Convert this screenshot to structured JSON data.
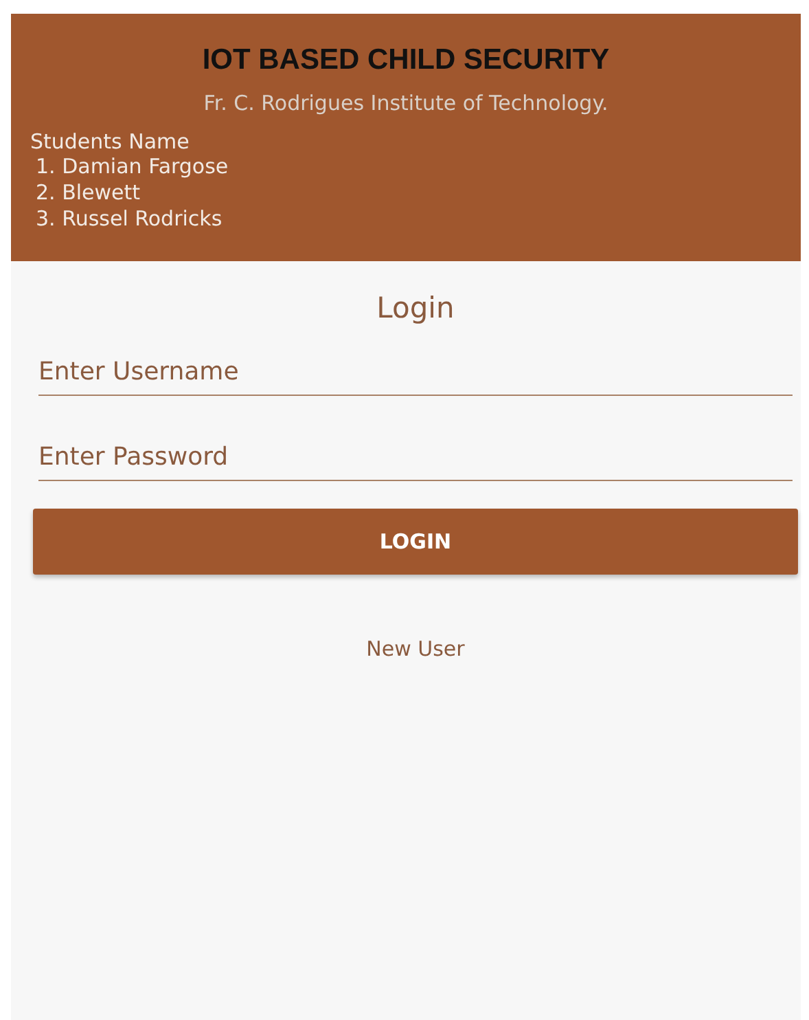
{
  "header": {
    "title": "IOT BASED CHILD SECURITY",
    "subtitle": "Fr. C. Rodrigues Institute of Technology.",
    "students_label": "Students Name",
    "students": [
      "1. Damian Fargose",
      "2. Blewett",
      "3. Russel Rodricks"
    ]
  },
  "login": {
    "heading": "Login",
    "fields": [
      {
        "placeholder": "Enter Username"
      },
      {
        "placeholder": "Enter Password"
      }
    ],
    "button": "LOGIN",
    "link": "New User"
  }
}
